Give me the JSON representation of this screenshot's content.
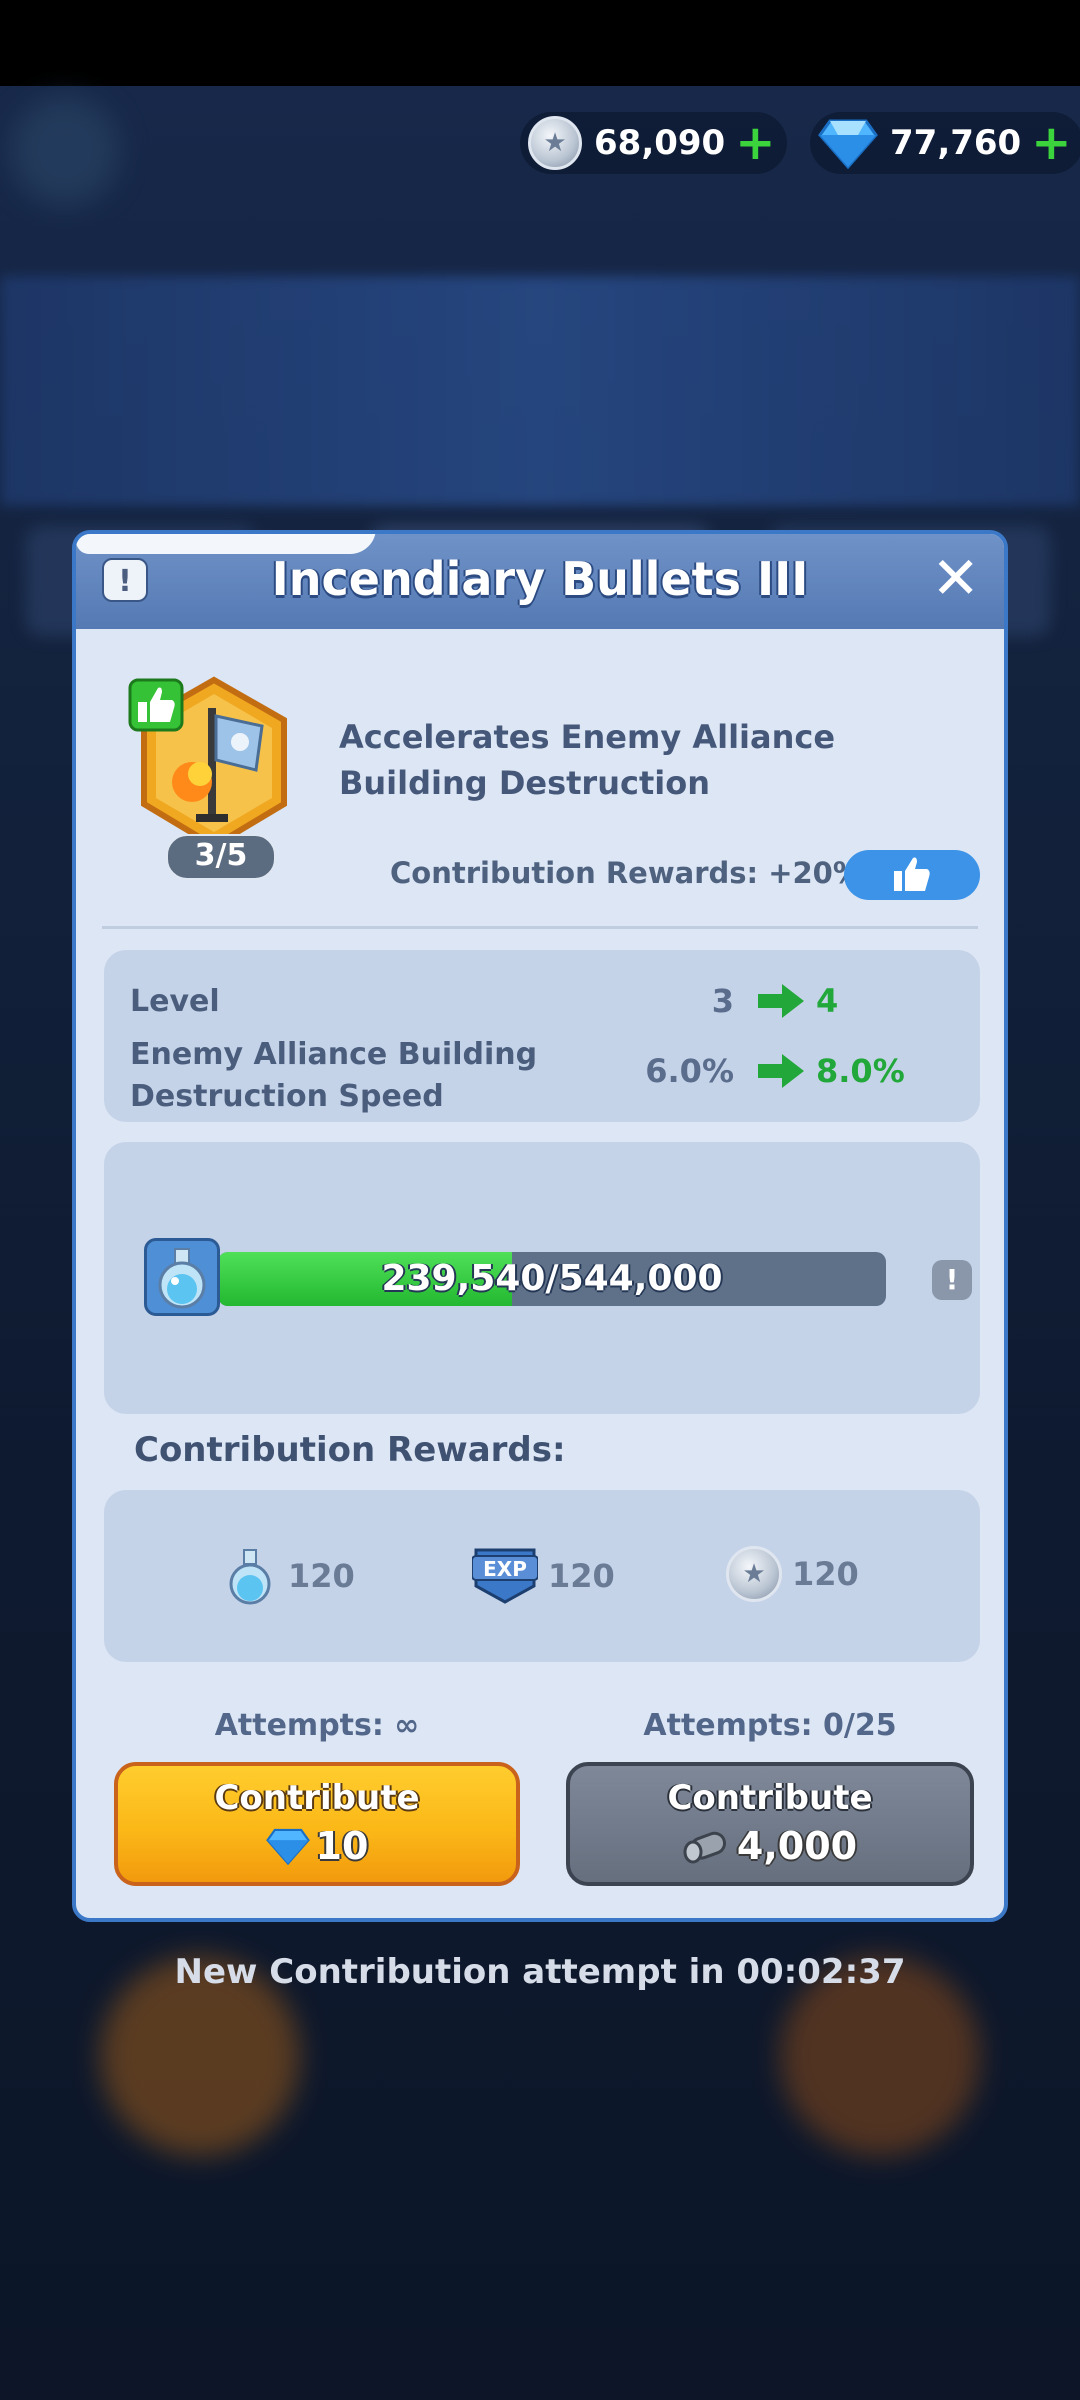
{
  "currencies": [
    {
      "icon": "silver-coin-icon",
      "value": "68,090"
    },
    {
      "icon": "gem-icon",
      "value": "77,760"
    }
  ],
  "modal": {
    "title": "Incendiary Bullets III",
    "level_badge": "3/5",
    "description": "Accelerates Enemy Alliance Building Destruction",
    "contribution_bonus": "Contribution Rewards: +20%",
    "stats": [
      {
        "label": "Level",
        "from": "3",
        "to": "4"
      },
      {
        "label": "Enemy Alliance Building Destruction Speed",
        "from": "6.0%",
        "to": "8.0%"
      }
    ],
    "progress": {
      "current": 239540,
      "max": 544000,
      "text": "239,540/544,000"
    },
    "rewards_title": "Contribution Rewards:",
    "rewards": [
      {
        "icon": "potion-icon",
        "value": "120"
      },
      {
        "icon": "exp-icon",
        "value": "120"
      },
      {
        "icon": "silver-coin-icon",
        "value": "120"
      }
    ],
    "actions": [
      {
        "attempts": "Attempts: ∞",
        "label": "Contribute",
        "cost": "10",
        "cost_icon": "gem-icon"
      },
      {
        "attempts": "Attempts: 0/25",
        "label": "Contribute",
        "cost": "4,000",
        "cost_icon": "log-icon"
      }
    ],
    "exp_label": "EXP"
  },
  "timer": "New Contribution attempt in 00:02:37",
  "colors": {
    "accent": "#3b78c8",
    "gold_button": "#fbb817",
    "progress_green": "#2fc43a"
  }
}
